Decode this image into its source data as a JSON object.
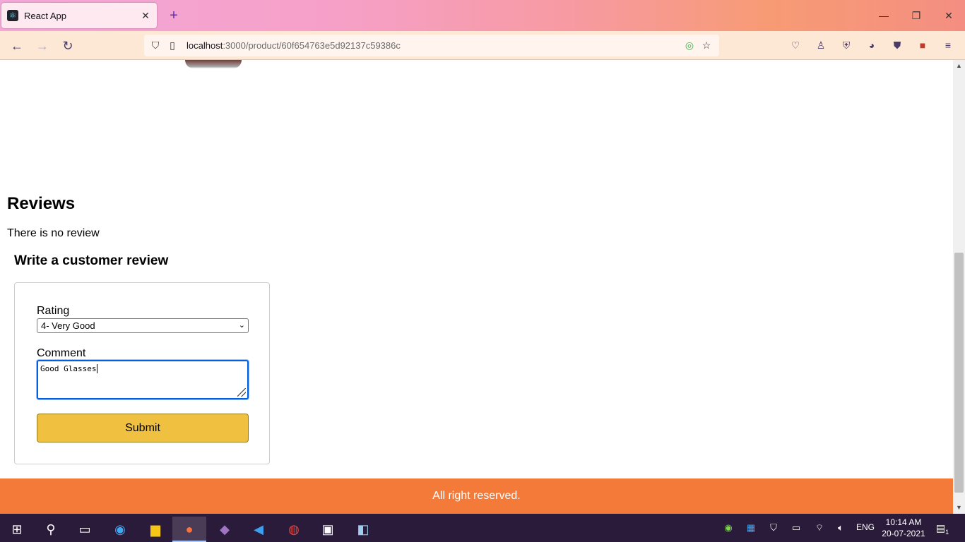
{
  "browser": {
    "tab_title": "React App",
    "tab_close": "✕",
    "new_tab": "+",
    "url_host": "localhost",
    "url_path": ":3000/product/60f654763e5d92137c59386c",
    "window_controls": [
      "—",
      "❐",
      "✕"
    ]
  },
  "page": {
    "reviews_heading": "Reviews",
    "no_review_text": "There is no review",
    "write_review_heading": "Write a customer review",
    "form": {
      "rating_label": "Rating",
      "rating_selected": "4- Very Good",
      "comment_label": "Comment",
      "comment_value": "Good Glasses",
      "submit_label": "Submit"
    },
    "footer_text": "All right reserved."
  },
  "taskbar": {
    "language": "ENG",
    "time": "10:14 AM",
    "date": "20-07-2021",
    "notification_count": "1"
  },
  "colors": {
    "footer": "#f47a3a",
    "submit_button": "#f0c040",
    "focus_ring": "#0060df"
  }
}
